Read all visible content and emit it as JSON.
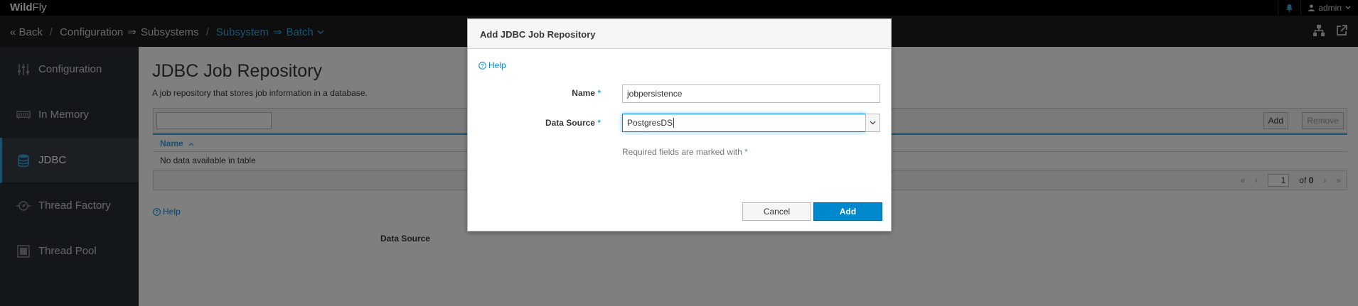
{
  "header": {
    "logo_bold": "Wild",
    "logo_rest": "Fly",
    "user": "admin",
    "colors": {
      "brand": "#030303",
      "accent": "#39a5dc",
      "primary_button": "#0088ce"
    }
  },
  "breadcrumb": {
    "back": "Back",
    "parts": [
      "Configuration",
      "⇒",
      "Subsystems",
      "/",
      "Subsystem",
      "⇒",
      "Batch"
    ]
  },
  "sidebar": {
    "items": [
      {
        "label": "Configuration",
        "icon": "sliders-icon"
      },
      {
        "label": "In Memory",
        "icon": "memory-icon"
      },
      {
        "label": "JDBC",
        "icon": "database-icon",
        "active": true
      },
      {
        "label": "Thread Factory",
        "icon": "thread-factory-icon"
      },
      {
        "label": "Thread Pool",
        "icon": "thread-pool-icon"
      }
    ]
  },
  "main": {
    "title": "JDBC Job Repository",
    "description": "A job repository that stores job information in a database.",
    "toolbar": {
      "add": "Add",
      "remove": "Remove"
    },
    "table": {
      "column": "Name",
      "empty_text": "No data available in table"
    },
    "pager": {
      "page": "1",
      "of_label": "of",
      "total": "0"
    },
    "help": "Help",
    "data_source_label": "Data Source"
  },
  "modal": {
    "title": "Add JDBC Job Repository",
    "help": "Help",
    "name_label": "Name",
    "name_value": "jobpersistence",
    "datasource_label": "Data Source",
    "datasource_value": "PostgresDS",
    "required_note": "Required fields are marked with",
    "required_marker": "*",
    "cancel": "Cancel",
    "add": "Add"
  }
}
